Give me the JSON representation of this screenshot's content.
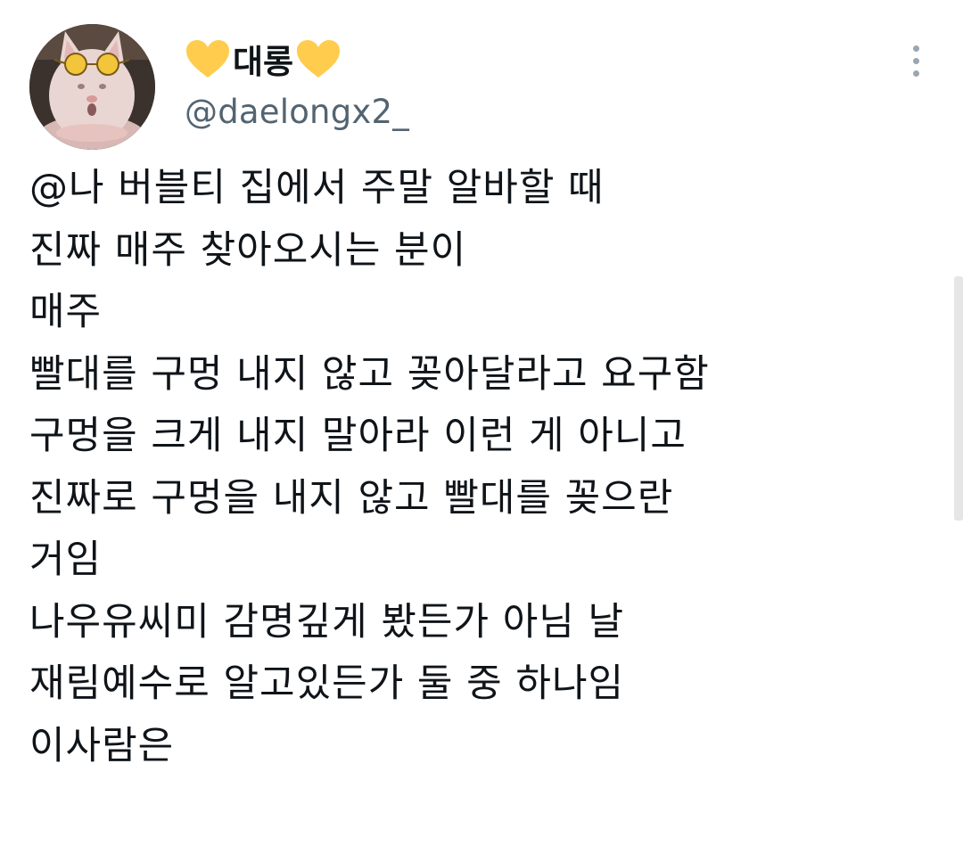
{
  "author": {
    "display_name": "대롱",
    "handle": "@daelongx2_",
    "name_emoji_left": "yellow-heart",
    "name_emoji_right": "yellow-heart",
    "heart_color": "#FFCC4D"
  },
  "more_menu": {
    "icon": "more-vertical-icon"
  },
  "tweet": {
    "lines": [
      "@나 버블티 집에서 주말 알바할 때",
      "진짜 매주 찾아오시는 분이",
      "매주",
      "빨대를 구멍 내지 않고 꽂아달라고 요구함",
      "구멍을 크게 내지 말아라 이런 게 아니고",
      "진짜로 구멍을 내지 않고 빨대를 꽂으란",
      "거임",
      "나우유씨미 감명깊게 봤든가 아님 날",
      "재림예수로 알고있든가 둘 중 하나임",
      "이사람은"
    ]
  },
  "colors": {
    "text": "#0F1419",
    "handle": "#536471"
  }
}
